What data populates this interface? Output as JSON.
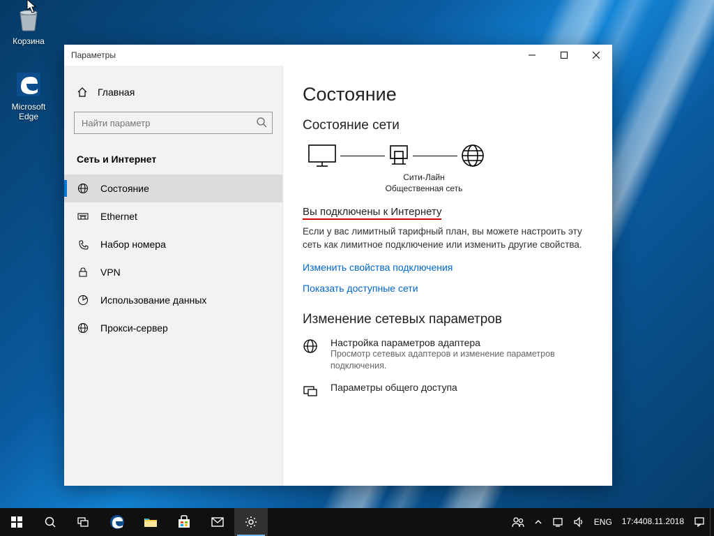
{
  "desktop": {
    "icons": [
      {
        "name": "recycle-bin",
        "label": "Корзина"
      },
      {
        "name": "edge",
        "label": "Microsoft Edge"
      }
    ]
  },
  "window": {
    "title": "Параметры",
    "home": "Главная",
    "search_placeholder": "Найти параметр",
    "category": "Сеть и Интернет",
    "nav": [
      {
        "label": "Состояние",
        "icon": "globe"
      },
      {
        "label": "Ethernet",
        "icon": "ethernet"
      },
      {
        "label": "Набор номера",
        "icon": "dialup"
      },
      {
        "label": "VPN",
        "icon": "vpn"
      },
      {
        "label": "Использование данных",
        "icon": "data"
      },
      {
        "label": "Прокси-сервер",
        "icon": "proxy"
      }
    ],
    "content": {
      "page_title": "Состояние",
      "network_status": "Состояние сети",
      "diagram": {
        "name": "Сити-Лайн",
        "type": "Общественная сеть"
      },
      "connected": "Вы подключены к Интернету",
      "para": "Если у вас лимитный тарифный план, вы можете настроить эту сеть как лимитное подключение или изменить другие свойства.",
      "link1": "Изменить свойства подключения",
      "link2": "Показать доступные сети",
      "change_title": "Изменение сетевых параметров",
      "opt1_t": "Настройка параметров адаптера",
      "opt1_d": "Просмотр сетевых адаптеров и изменение параметров подключения.",
      "opt2_t": "Параметры общего доступа"
    }
  },
  "taskbar": {
    "lang": "ENG",
    "time": "17:44",
    "date": "08.11.2018"
  }
}
